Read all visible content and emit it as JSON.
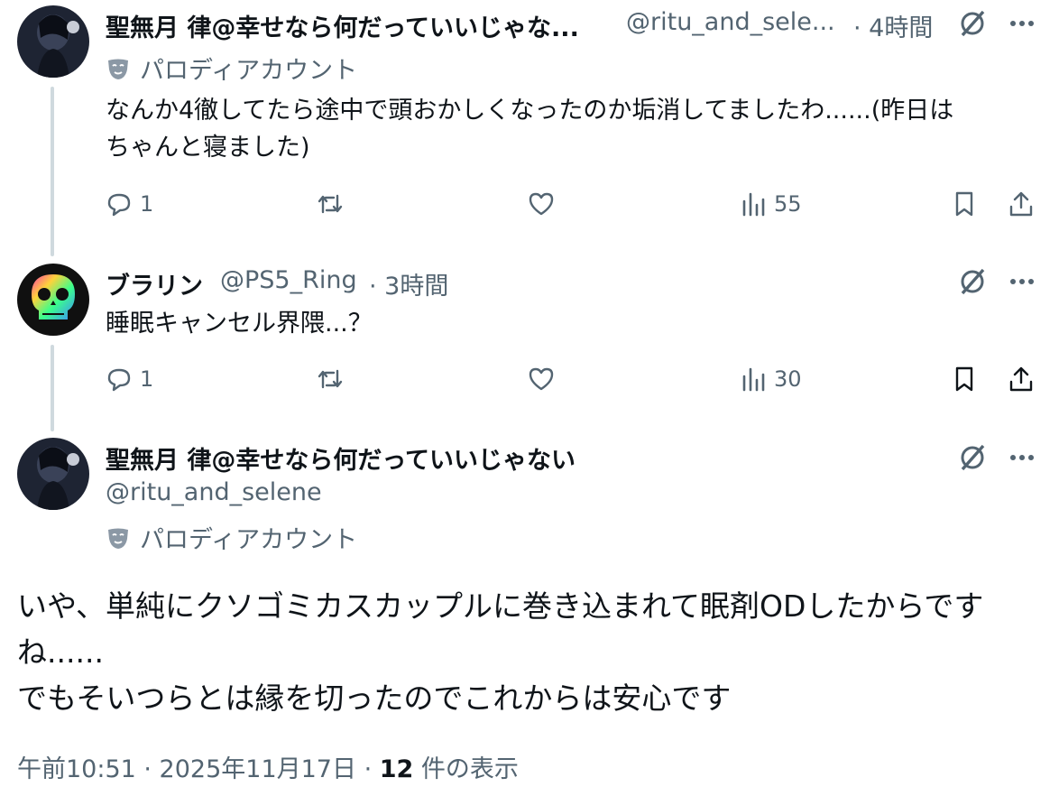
{
  "tweet1": {
    "name": "聖無月 律@幸せなら何だっていいじゃな...",
    "handle": "@ritu_and_sele...",
    "time": "· 4時間",
    "badge": "パロディアカウント",
    "text_line1": "なんか4徹してたら途中で頭おかしくなったのか垢消してましたわ......(昨日は",
    "text_line2": "ちゃんと寝ました)",
    "replies": "1",
    "views": "55"
  },
  "tweet2": {
    "name": "ブラリン",
    "handle": "@PS5_Ring",
    "time": "· 3時間",
    "text": "睡眠キャンセル界隈...？",
    "replies": "1",
    "views": "30"
  },
  "main": {
    "name": "聖無月 律@幸せなら何だっていいじゃない",
    "handle": "@ritu_and_selene",
    "badge": "パロディアカウント",
    "text_line1": "いや、単純にクソゴミカスカップルに巻き込まれて眠剤ODしたからです",
    "text_line2": "ね......",
    "text_line3": "でもそいつらとは縁を切ったのでこれからは安心です",
    "footer_time": "午前10:51 · 2025年11月17日 · ",
    "footer_views": "12",
    "footer_views_label": " 件の表示"
  },
  "colors": {
    "text": "#0f1419",
    "muted": "#536471",
    "thread": "#cfd9de"
  },
  "icons": [
    "grok-icon",
    "more-icon",
    "reply-icon",
    "retweet-icon",
    "like-icon",
    "views-icon",
    "bookmark-icon",
    "share-icon",
    "parody-mask-icon"
  ]
}
